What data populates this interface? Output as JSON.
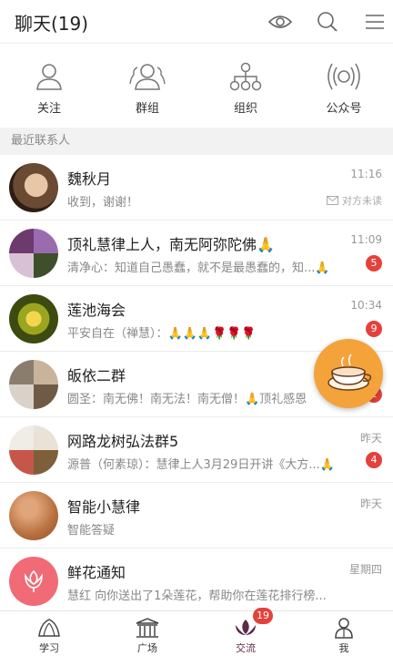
{
  "header": {
    "title": "聊天(19)",
    "icons": [
      "eye-icon",
      "search-icon",
      "menu-icon"
    ]
  },
  "quick_actions": [
    {
      "label": "关注",
      "icon": "person-icon"
    },
    {
      "label": "群组",
      "icon": "group-icon"
    },
    {
      "label": "组织",
      "icon": "org-chart-icon"
    },
    {
      "label": "公众号",
      "icon": "broadcast-icon"
    }
  ],
  "section_title": "最近联系人",
  "chats": [
    {
      "name": "魏秋月",
      "preview": "收到，谢谢！",
      "time": "11:16",
      "status": "对方未读"
    },
    {
      "name": "顶礼慧律上人，南无阿弥陀佛🙏",
      "preview": "清净心：知道自己愚蠢，就不是最愚蠢的，知...🙏",
      "time": "11:09",
      "badge": "5"
    },
    {
      "name": "莲池海会",
      "preview": "平安自在（禅慧）：🙏🙏🙏🌹🌹🌹",
      "time": "10:34",
      "badge": "9"
    },
    {
      "name": "皈依二群",
      "preview": "圆圣：南无佛！南无法！南无僧！🙏顶礼感恩",
      "time": "",
      "badge": "1"
    },
    {
      "name": "网路龙树弘法群5",
      "preview": "源普（何素琼）：慧律上人3月29日开讲《大方...🙏",
      "time": "昨天",
      "badge": "4"
    },
    {
      "name": "智能小慧律",
      "preview": "智能答疑",
      "time": "昨天"
    },
    {
      "name": "鲜花通知",
      "preview": "慧红 向你送出了1朵莲花，帮助你在莲花排行榜...",
      "time": "星期四"
    }
  ],
  "tabbar": {
    "tabs": [
      {
        "label": "学习",
        "icon": "conch-icon"
      },
      {
        "label": "广场",
        "icon": "temple-icon"
      },
      {
        "label": "交流",
        "icon": "lotus-icon",
        "badge": "19"
      },
      {
        "label": "我",
        "icon": "monk-icon"
      }
    ]
  },
  "colors": {
    "accent": "#e5413b",
    "separator": "#f2f2f2",
    "icon": "#888888",
    "active_tab": "#5a2a4a"
  }
}
